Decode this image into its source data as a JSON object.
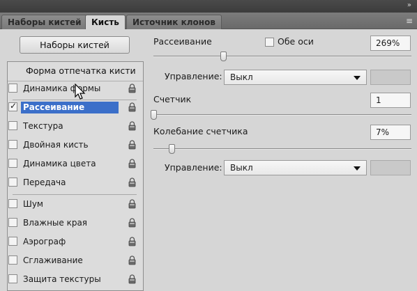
{
  "window": {
    "collapse_glyph": "»"
  },
  "tabs": [
    {
      "label": "Наборы кистей"
    },
    {
      "label": "Кисть"
    },
    {
      "label": "Источник клонов"
    }
  ],
  "menu_icon": "panel-menu-icon",
  "presets_button": "Наборы кистей",
  "list": {
    "header": "Форма отпечатка кисти",
    "items": [
      {
        "label": "Динамика формы",
        "checked": false
      },
      {
        "label": "Рассеивание",
        "checked": true,
        "selected": true
      },
      {
        "label": "Текстура",
        "checked": false
      },
      {
        "label": "Двойная кисть",
        "checked": false
      },
      {
        "label": "Динамика цвета",
        "checked": false
      },
      {
        "label": "Передача",
        "checked": false
      },
      {
        "label": "Шум",
        "checked": false
      },
      {
        "label": "Влажные края",
        "checked": false
      },
      {
        "label": "Аэрограф",
        "checked": false
      },
      {
        "label": "Сглаживание",
        "checked": false
      },
      {
        "label": "Защита текстуры",
        "checked": false
      }
    ]
  },
  "scatter": {
    "label": "Рассеивание",
    "both_axes_label": "Обе оси",
    "value": "269%",
    "control_label": "Управление:",
    "control_value": "Выкл",
    "slider_fraction": 0.27
  },
  "count": {
    "label": "Счетчик",
    "value": "1",
    "slider_fraction": 0.0
  },
  "count_jitter": {
    "label": "Колебание счетчика",
    "value": "7%",
    "control_label": "Управление:",
    "control_value": "Выкл",
    "slider_fraction": 0.07
  }
}
